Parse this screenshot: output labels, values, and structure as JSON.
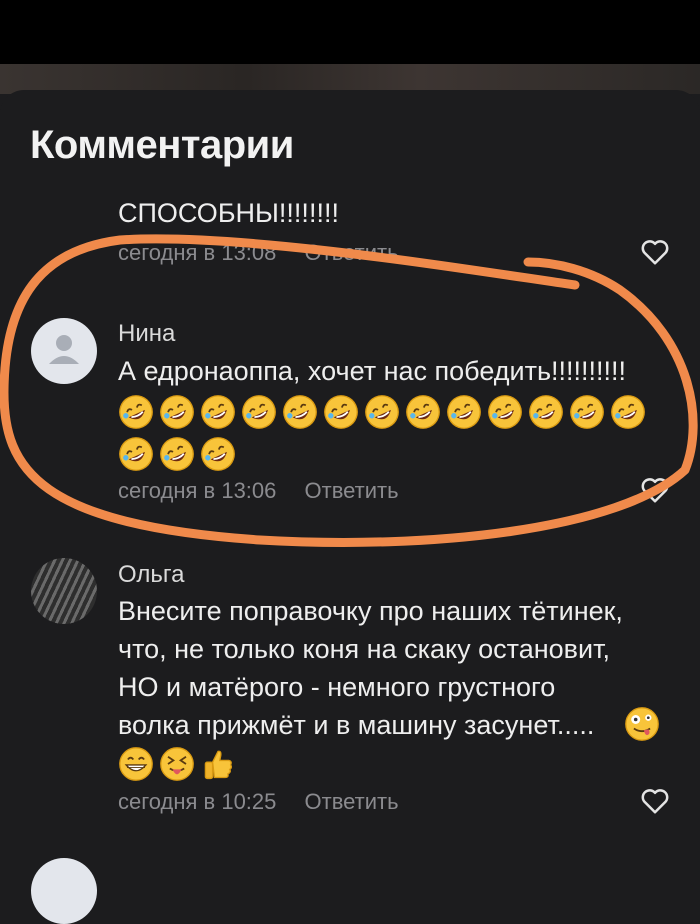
{
  "header": {
    "title": "Комментарии"
  },
  "comments": [
    {
      "text": "СПОСОБНЫ!!!!!!!!",
      "meta_time": "сегодня в 13:08",
      "reply_label": "Ответить"
    },
    {
      "name": "Нина",
      "text": "А едронаоппа, хочет нас победить!!!!!!!!!!",
      "emojis": [
        "rofl",
        "rofl",
        "rofl",
        "rofl",
        "rofl",
        "rofl",
        "rofl",
        "rofl",
        "rofl",
        "rofl",
        "rofl",
        "rofl",
        "rofl",
        "rofl",
        "rofl",
        "rofl"
      ],
      "meta_time": "сегодня в 13:06",
      "reply_label": "Ответить"
    },
    {
      "name": "Ольга",
      "text_lines": [
        "Внесите поправочку про наших тётинек,",
        "что, не только коня на скаку остановит,",
        "НО и матёрого - немного грустного",
        "волка прижмёт и в машину засунет....."
      ],
      "emojis": [
        "zany-face",
        "grinning-face",
        "squinting-tongue-face",
        "thumbs-up"
      ],
      "meta_time": "сегодня в 10:25",
      "reply_label": "Ответить"
    }
  ],
  "icons": {
    "like": "heart-outline-icon",
    "avatar_default": "person-icon"
  },
  "colors": {
    "background": "#1c1c1e",
    "text": "#eeeeee",
    "meta": "#8b8b8f",
    "annotation": "#f08a4b"
  }
}
